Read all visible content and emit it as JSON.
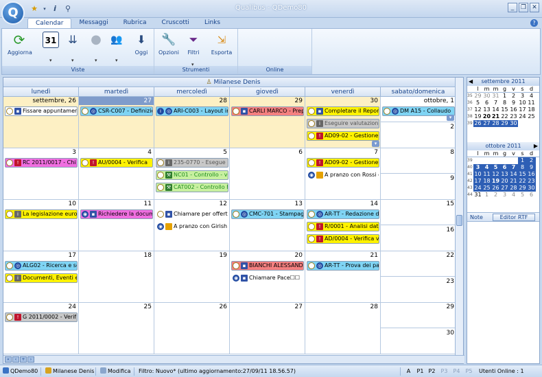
{
  "window": {
    "title": "Qualibus - QDemo80",
    "app_glyph": "Q"
  },
  "ribbon": {
    "tabs": [
      "Calendar",
      "Messaggi",
      "Rubrica",
      "Cruscotti",
      "Links"
    ],
    "active_tab": "Calendar",
    "groups": {
      "viste_label": "Viste",
      "strumenti_label": "Strumenti",
      "online_label": "Online"
    },
    "buttons": {
      "aggiorna": "Aggiorna",
      "mese_glyph": "31",
      "oggi": "Oggi",
      "opzioni": "Opzioni",
      "filtri": "Filtri",
      "esporta": "Esporta"
    }
  },
  "calendar": {
    "resource": "Milanese Denis",
    "day_headers": [
      "lunedì",
      "martedì",
      "mercoledì",
      "giovedì",
      "venerdì",
      "sabato/domenica"
    ],
    "weeks": [
      {
        "days": [
          "settembre, 26",
          "27",
          "28",
          "29",
          "30"
        ],
        "sat": "ottobre, 1",
        "sun": "2"
      },
      {
        "days": [
          "3",
          "4",
          "5",
          "6",
          "7"
        ],
        "sat": "8",
        "sun": "9"
      },
      {
        "days": [
          "10",
          "11",
          "12",
          "13",
          "14"
        ],
        "sat": "15",
        "sun": "16"
      },
      {
        "days": [
          "17",
          "18",
          "19",
          "20",
          "21"
        ],
        "sat": "22",
        "sun": "23"
      },
      {
        "days": [
          "24",
          "25",
          "26",
          "27",
          "28"
        ],
        "sat": "29",
        "sun": "30"
      }
    ],
    "appointments": {
      "w0_mon_0": "Fissare appuntamen",
      "w0_tue_0": "CSR-C007 - Definizio",
      "w0_wed_0": "ARI-C003 - Layout in",
      "w0_thu_0": "CARLI MARCO - Prep",
      "w0_fri_0": "Completare il Report",
      "w0_fri_1": "Eseguire valutazione",
      "w0_fri_2": "AD09-02 - Gestione",
      "w0_sat_0": "DM A15 - Collaudo",
      "w1_mon_0": "RC 2011/0017 - Chi",
      "w1_tue_0": "AU/0004 - Verifica",
      "w1_wed_0": "235-0770 - Esegue",
      "w1_wed_1": "NC01 - Controllo - v",
      "w1_wed_2": "CAT002 - Controllo F",
      "w1_fri_0": "AD09-02 - Gestione",
      "w1_fri_1": "A pranzo con Rossi c",
      "w2_mon_0": "La legislazione europ",
      "w2_tue_0": "Richiedere la docume",
      "w2_wed_0": "Chiamare per offerta",
      "w2_wed_1": "A pranzo con Girish",
      "w2_thu_0": "CMC-701 - Stampagg",
      "w2_fri_0": "AR-TT - Redazione d",
      "w2_fri_1": "R/0001 - Analisi dati",
      "w2_fri_2": "AD/0004 - Verifica v",
      "w3_mon_0": "ALG02 - Ricerca e se",
      "w3_mon_1": "Documenti, Eventi e",
      "w3_thu_0": "BIANCHI ALESSAND",
      "w3_thu_1": "Chiamare Pace☐☐",
      "w3_fri_0": "AR-TT - Prova dei pa",
      "w4_mon_0": "G 2011/0002 - Verif"
    }
  },
  "mini_calendars": [
    {
      "title": "settembre 2011",
      "dow": [
        "l",
        "m",
        "m",
        "g",
        "v",
        "s",
        "d"
      ],
      "rows": [
        {
          "wk": "35",
          "days": [
            "29",
            "30",
            "31",
            "1",
            "2",
            "3",
            "4"
          ]
        },
        {
          "wk": "36",
          "days": [
            "5",
            "6",
            "7",
            "8",
            "9",
            "10",
            "11"
          ]
        },
        {
          "wk": "37",
          "days": [
            "12",
            "13",
            "14",
            "15",
            "16",
            "17",
            "18"
          ]
        },
        {
          "wk": "38",
          "days": [
            "19",
            "20",
            "21",
            "22",
            "23",
            "24",
            "25"
          ]
        },
        {
          "wk": "39",
          "days": [
            "26",
            "27",
            "28",
            "29",
            "30",
            "",
            ""
          ]
        }
      ]
    },
    {
      "title": "ottobre 2011",
      "dow": [
        "l",
        "m",
        "m",
        "g",
        "v",
        "s",
        "d"
      ],
      "rows": [
        {
          "wk": "39",
          "days": [
            "",
            "",
            "",
            "",
            "",
            "1",
            "2"
          ]
        },
        {
          "wk": "40",
          "days": [
            "3",
            "4",
            "5",
            "6",
            "7",
            "8",
            "9"
          ]
        },
        {
          "wk": "41",
          "days": [
            "10",
            "11",
            "12",
            "13",
            "14",
            "15",
            "16"
          ]
        },
        {
          "wk": "42",
          "days": [
            "17",
            "18",
            "19",
            "20",
            "21",
            "22",
            "23"
          ]
        },
        {
          "wk": "43",
          "days": [
            "24",
            "25",
            "26",
            "27",
            "28",
            "29",
            "30"
          ]
        },
        {
          "wk": "44",
          "days": [
            "31",
            "1",
            "2",
            "3",
            "4",
            "5",
            "6"
          ]
        }
      ]
    }
  ],
  "notes": {
    "label": "Note",
    "rtf_button": "Editor RTF"
  },
  "statusbar": {
    "db": "QDemo80",
    "user": "Milanese Denis",
    "mode": "Modifica",
    "filter": "Filtro: Nuovo* (ultimo aggiornamento:27/09/11 18.56.57)",
    "priorities": [
      "A",
      "P1",
      "P2",
      "P3",
      "P4",
      "P5"
    ],
    "online": "Utenti Online : 1"
  },
  "colors": {
    "other_month_bg": "#fdf0c4",
    "accent_blue": "#15428b",
    "appt_cyan": "#7fd4f4",
    "appt_yellow": "#fff200",
    "appt_red": "#f48080",
    "appt_pink": "#f06ee0",
    "appt_grey": "#c8c8c8",
    "appt_green": "#c8f0a0"
  }
}
